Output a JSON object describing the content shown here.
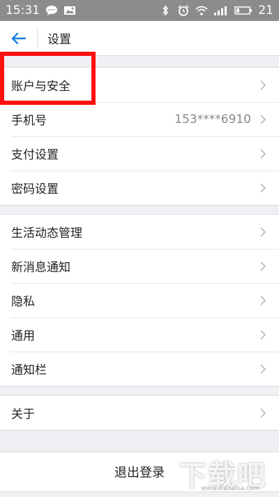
{
  "status_bar": {
    "time": "15:31",
    "battery": "21",
    "icons": [
      "chat-bubble-icon",
      "image-icon",
      "bluetooth-icon",
      "alarm-icon",
      "wifi-icon",
      "signal-icon",
      "battery-icon"
    ]
  },
  "nav": {
    "title": "设置",
    "back_icon": "back-arrow-icon"
  },
  "sections": [
    {
      "items": [
        {
          "label": "账户与安全",
          "value": ""
        },
        {
          "label": "手机号",
          "value": "153****6910"
        },
        {
          "label": "支付设置",
          "value": ""
        },
        {
          "label": "密码设置",
          "value": ""
        }
      ]
    },
    {
      "items": [
        {
          "label": "生活动态管理",
          "value": ""
        },
        {
          "label": "新消息通知",
          "value": ""
        },
        {
          "label": "隐私",
          "value": ""
        },
        {
          "label": "通用",
          "value": ""
        },
        {
          "label": "通知栏",
          "value": ""
        }
      ]
    },
    {
      "items": [
        {
          "label": "关于",
          "value": ""
        }
      ]
    }
  ],
  "logout_label": "退出登录",
  "watermark": {
    "logo": "下载吧",
    "url": "www.xiazaiba.com"
  },
  "colors": {
    "accent": "#1a7ee0",
    "highlight": "#ff1010",
    "status_bar": "#8c8c8c"
  }
}
